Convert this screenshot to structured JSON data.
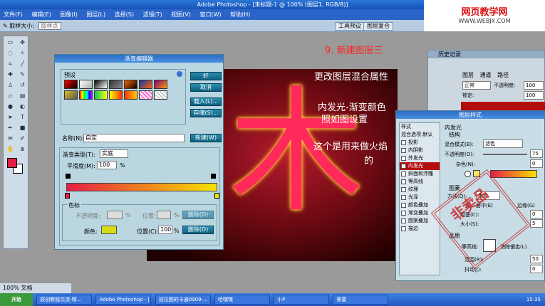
{
  "window": {
    "title": "Adobe Photoshop - [未标题-1 @ 100% (图层1, RGB/8)]"
  },
  "menu": [
    "文件(F)",
    "编辑(E)",
    "图像(I)",
    "图层(L)",
    "选择(S)",
    "滤镜(T)",
    "视图(V)",
    "窗口(W)",
    "帮助(H)"
  ],
  "options": {
    "sample_size_label": "取样大小:",
    "sample_size_value": "取样点",
    "tab1": "工具预设",
    "tab2": "图层复合"
  },
  "logo": {
    "line1": "网页教学网",
    "line2": "WWW.WEBJX.COM"
  },
  "gradient_dialog": {
    "title": "渐变编辑器",
    "presets_label": "预设",
    "name_label": "名称(N):",
    "name_value": "自定",
    "new_button": "新建(W)",
    "ok": "好",
    "cancel": "取消",
    "load": "载入(L)...",
    "save": "存储(S)...",
    "type_label": "渐变类型(T):",
    "type_value": "实底",
    "smooth_label": "平滑度(M):",
    "smooth_value": "100",
    "pct": "%",
    "stops_label": "色标",
    "opacity_label": "不透明度:",
    "location_label": "位置:",
    "delete_btn": "删除(D)",
    "color_label": "颜色:",
    "location2_label": "位置(C):",
    "location2_value": "100",
    "swatches": [
      "#ff0000",
      "#e8e8e8",
      "#ffffff",
      "#2a2a2a",
      "#ff6600",
      "#1034a6",
      "#800080",
      "#e0c020",
      "#ff00aa",
      "#00cc66",
      "#ffff00",
      "#ff3300",
      "#ff66cc",
      "#cccccc"
    ]
  },
  "annotations": {
    "step": "9. 新建图层三",
    "line1": "更改图层混合属性",
    "line2": "内发光-渐变颜色",
    "line3": "照如图设置",
    "line4": "这个是用来做火焰",
    "line5": "的"
  },
  "history": {
    "tab1": "历史记录",
    "tab2": "图层",
    "tab3": "通道",
    "tab4": "路径",
    "mode": "正常",
    "opacity_label": "不透明度:",
    "opacity_value": "100",
    "lock_label": "锁定:",
    "fill_value": "100"
  },
  "layer_style": {
    "title": "图层样式",
    "style_label": "样式",
    "blend_options": "混合选项:默认",
    "items": [
      {
        "label": "投影",
        "on": false
      },
      {
        "label": "内阴影",
        "on": false
      },
      {
        "label": "外发光",
        "on": false
      },
      {
        "label": "内发光",
        "on": true
      },
      {
        "label": "斜面和浮雕",
        "on": false
      },
      {
        "label": "等高线",
        "on": false
      },
      {
        "label": "纹理",
        "on": false
      },
      {
        "label": "光泽",
        "on": false
      },
      {
        "label": "颜色叠加",
        "on": false
      },
      {
        "label": "渐变叠加",
        "on": false
      },
      {
        "label": "图案叠加",
        "on": false
      },
      {
        "label": "描边",
        "on": false
      }
    ],
    "inner_glow": "内发光",
    "structure": "结构",
    "blend_mode_label": "混合模式(B):",
    "blend_mode_value": "滤色",
    "opacity_label": "不透明度(O):",
    "opacity_value": "75",
    "noise_label": "杂色(N):",
    "noise_value": "0",
    "elements": "图素",
    "method_label": "方法(Q):",
    "method_value": "柔和",
    "source": "源:",
    "center": "居中(E)",
    "edge": "边缘(G)",
    "choke_label": "阻塞(C):",
    "choke_value": "0",
    "size_label": "大小(S):",
    "size_value": "5",
    "quality": "品质",
    "contour_label": "等高线:",
    "antialias": "消除锯齿(L)",
    "range_label": "范围(R):",
    "range_value": "50",
    "jitter_label": "抖动(J):",
    "jitter_value": "0"
  },
  "stamp": "非卖品",
  "status": "100% 文档",
  "taskbar": {
    "start": "开始",
    "items": [
      "原创教程交流-精...",
      "Adobe Photoshop - [...",
      "拍拉图的卡通0909-...",
      "哈嘿嘿",
      "小P",
      "需要"
    ],
    "clock": "15:35"
  }
}
